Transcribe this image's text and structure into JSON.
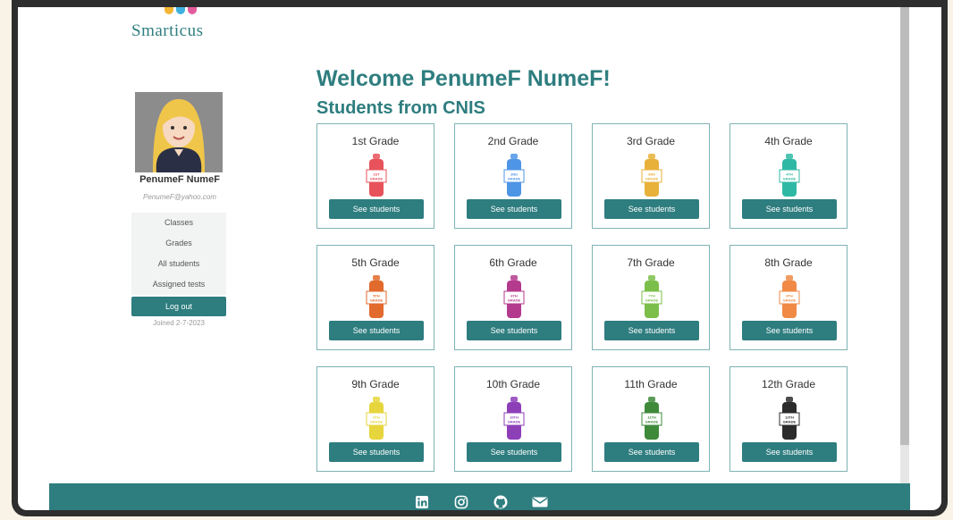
{
  "brand": {
    "name": "Smarticus"
  },
  "profile": {
    "name": "PenumeF NumeF",
    "email": "PenumeF@yahoo.com",
    "joined": "Joined 2-7-2023"
  },
  "menu": {
    "items": [
      {
        "label": "Classes"
      },
      {
        "label": "Grades"
      },
      {
        "label": "All students"
      },
      {
        "label": "Assigned tests"
      }
    ],
    "logout": "Log out"
  },
  "main": {
    "welcome": "Welcome PenumeF NumeF!",
    "subtitle": "Students from CNIS",
    "button_label": "See students",
    "grades": [
      {
        "title": "1st Grade",
        "badge": "1ST GRADE",
        "color": "#e8525a"
      },
      {
        "title": "2nd Grade",
        "badge": "2ND GRADE",
        "color": "#4f95e6"
      },
      {
        "title": "3rd Grade",
        "badge": "3RD GRADE",
        "color": "#e8b13a"
      },
      {
        "title": "4th Grade",
        "badge": "4TH GRADE",
        "color": "#2fb9a5"
      },
      {
        "title": "5th Grade",
        "badge": "5TH GRADE",
        "color": "#e26a2c"
      },
      {
        "title": "6th Grade",
        "badge": "6TH GRADE",
        "color": "#b43a8e"
      },
      {
        "title": "7th Grade",
        "badge": "7TH GRADE",
        "color": "#7bbf4a"
      },
      {
        "title": "8th Grade",
        "badge": "8TH GRADE",
        "color": "#f08a45"
      },
      {
        "title": "9th Grade",
        "badge": "9TH GRADE",
        "color": "#e6d53c"
      },
      {
        "title": "10th Grade",
        "badge": "10TH GRADE",
        "color": "#8d3fb8"
      },
      {
        "title": "11th Grade",
        "badge": "11TH GRADE",
        "color": "#3f8a3a"
      },
      {
        "title": "12th Grade",
        "badge": "12TH GRADE",
        "color": "#2b2b2b"
      }
    ]
  },
  "footer": {
    "icons": [
      "linkedin-icon",
      "instagram-icon",
      "github-icon",
      "mail-icon"
    ]
  }
}
